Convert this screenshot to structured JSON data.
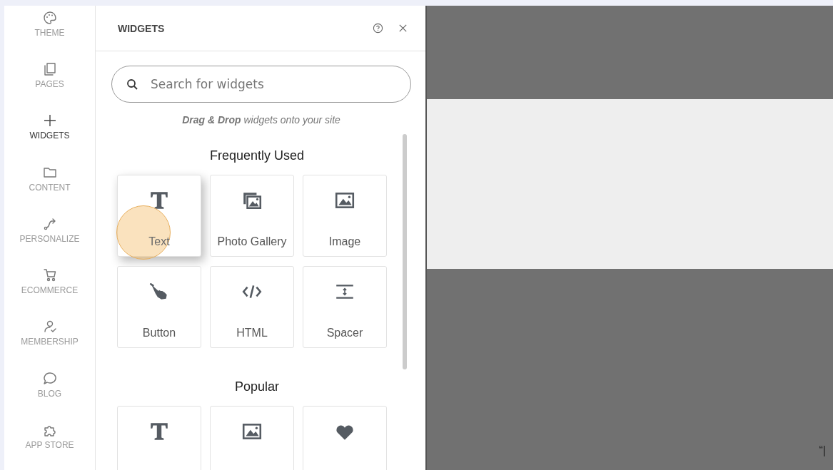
{
  "sidebar": {
    "items": [
      {
        "kind": "palette",
        "label": "THEME",
        "selected": false
      },
      {
        "kind": "pages",
        "label": "PAGES",
        "selected": false
      },
      {
        "kind": "plus",
        "label": "WIDGETS",
        "selected": true
      },
      {
        "kind": "folder",
        "label": "CONTENT",
        "selected": false
      },
      {
        "kind": "path",
        "label": "PERSONALIZE",
        "selected": false
      },
      {
        "kind": "cart",
        "label": "ECOMMERCE",
        "selected": false
      },
      {
        "kind": "member",
        "label": "MEMBERSHIP",
        "selected": false
      },
      {
        "kind": "chat",
        "label": "BLOG",
        "selected": false
      },
      {
        "kind": "puzzle",
        "label": "APP STORE",
        "selected": false
      }
    ]
  },
  "panel": {
    "title": "WIDGETS",
    "search": {
      "placeholder": "Search for widgets"
    },
    "hint": "**Drag & Drop** widgets onto your site",
    "sections": [
      {
        "title": "Frequently Used",
        "widgets": [
          {
            "kind": "text",
            "label": "Text",
            "hovered": true
          },
          {
            "kind": "gallery",
            "label": "Photo Gallery",
            "hovered": false
          },
          {
            "kind": "image",
            "label": "Image",
            "hovered": false
          },
          {
            "kind": "hand",
            "label": "Button",
            "hovered": false
          },
          {
            "kind": "code",
            "label": "HTML",
            "hovered": false
          },
          {
            "kind": "spacer",
            "label": "Spacer",
            "hovered": false
          }
        ]
      },
      {
        "title": "Popular",
        "widgets": [
          {
            "kind": "text",
            "hovered": false
          },
          {
            "kind": "image",
            "hovered": false
          },
          {
            "kind": "heart",
            "hovered": false
          }
        ]
      }
    ]
  },
  "canvas": {
    "mark": "“|"
  }
}
